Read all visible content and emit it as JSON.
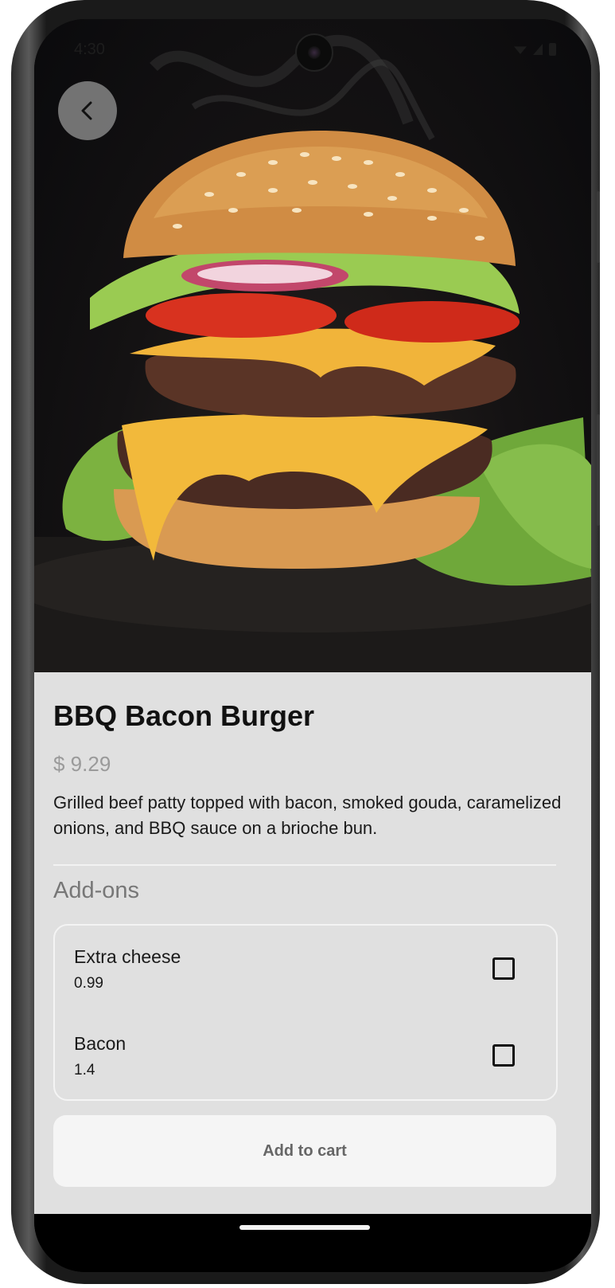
{
  "status_bar": {
    "time": "4:30"
  },
  "header": {
    "back_icon": "chevron-left-icon"
  },
  "hero": {
    "image_subject": "burger-photo"
  },
  "product": {
    "title": "BBQ Bacon Burger",
    "price": "$ 9.29",
    "description": "Grilled beef patty topped with bacon, smoked gouda, caramelized onions, and BBQ sauce on a brioche bun."
  },
  "addons": {
    "heading": "Add-ons",
    "items": [
      {
        "name": "Extra cheese",
        "price": "0.99",
        "checked": false
      },
      {
        "name": "Bacon",
        "price": "1.4",
        "checked": false
      }
    ]
  },
  "actions": {
    "add_to_cart": "Add to cart"
  },
  "colors": {
    "panel_background": "#e0e0e0",
    "button_background": "#f5f5f5",
    "price_gray": "#9a9a9a"
  }
}
